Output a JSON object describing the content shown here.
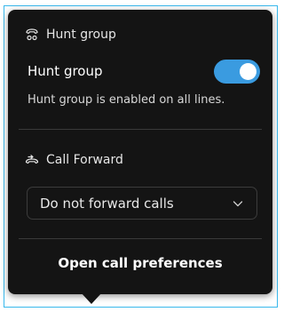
{
  "hunt_group": {
    "section_title": "Hunt group",
    "toggle_label": "Hunt group",
    "toggle_on": true,
    "helper_text": "Hunt group is enabled on all lines.",
    "icon": "hunt-group-icon"
  },
  "call_forward": {
    "section_title": "Call Forward",
    "icon": "call-forward-icon",
    "select_value": "Do not forward calls"
  },
  "footer": {
    "prefs_label": "Open call preferences"
  },
  "colors": {
    "toggle_accent": "#3a9be0",
    "popup_bg": "#141414",
    "frame_border": "#39b8ec"
  }
}
